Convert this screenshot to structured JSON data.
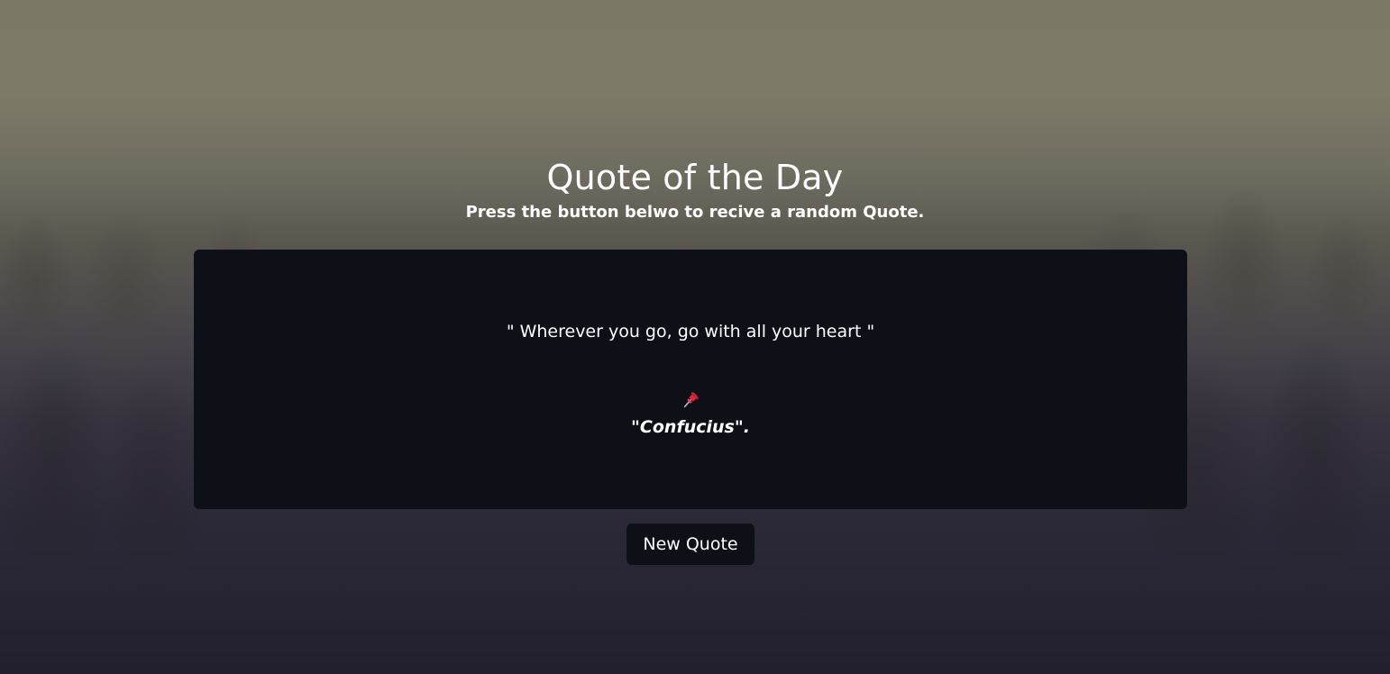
{
  "header": {
    "title": "Quote of the Day",
    "subtitle": "Press the button belwo to recive a random Quote."
  },
  "quote": {
    "text": "\" Wherever you go, go with all your heart \"",
    "author": "\"Confucius\".",
    "author_icon": "pushpin-icon"
  },
  "actions": {
    "new_quote_label": "New Quote"
  },
  "colors": {
    "card_background": "#0d1017",
    "text": "#ffffff",
    "pin": "#e0283a"
  }
}
